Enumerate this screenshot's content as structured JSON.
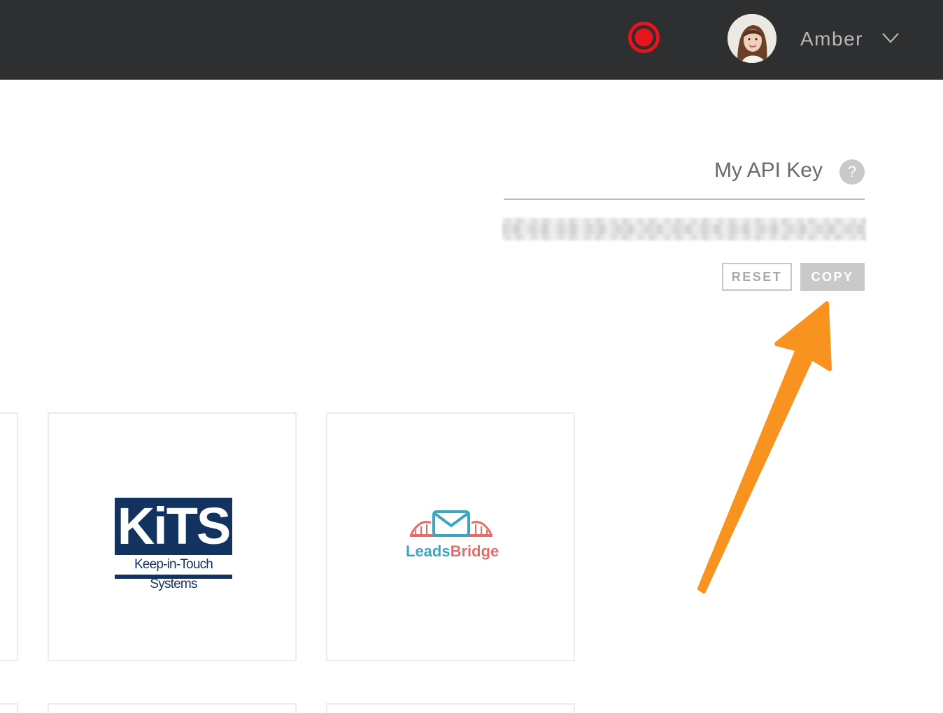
{
  "header": {
    "user_name": "Amber",
    "record_icon": "record-icon",
    "chevron_icon": "chevron-down-icon"
  },
  "api_key_panel": {
    "title": "My API Key",
    "help_symbol": "?",
    "reset_label": "RESET",
    "copy_label": "COPY"
  },
  "integrations": [
    {
      "name": "KiTS",
      "logo_title": "KiTS",
      "logo_subtitle": "Keep-in-Touch Systems"
    },
    {
      "name": "LeadsBridge",
      "logo_part_a": "Leads",
      "logo_part_b": "Bridge"
    }
  ],
  "colors": {
    "topbar": "#2e2f31",
    "record": "#e8141b",
    "arrow": "#f7931e",
    "kits_navy": "#12325f",
    "leads_teal": "#3aa6c0",
    "leads_coral": "#e96a66"
  }
}
